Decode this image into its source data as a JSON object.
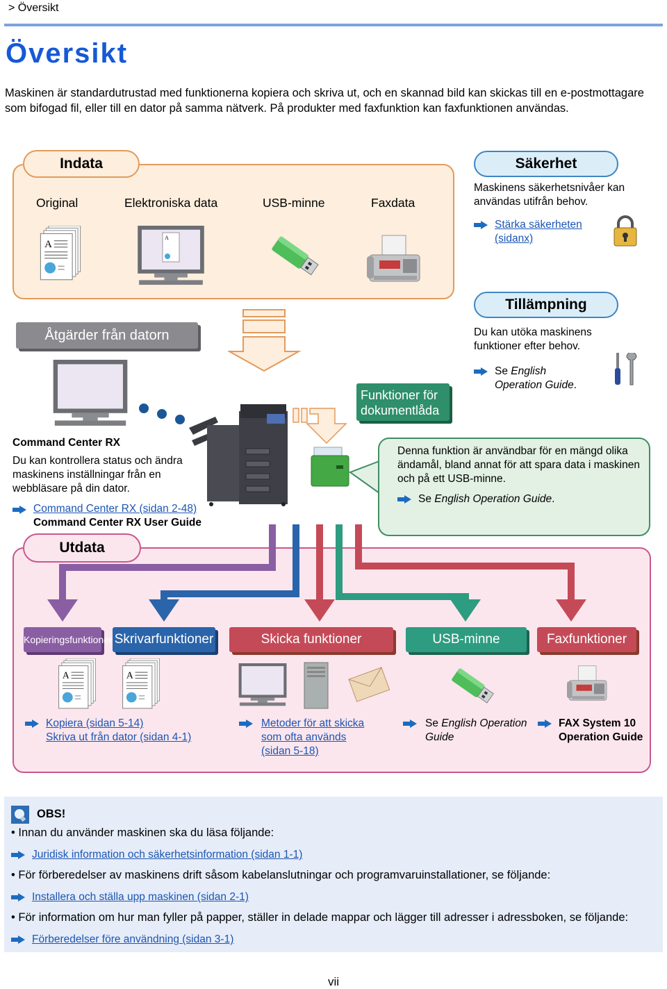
{
  "breadcrumb": "> Översikt",
  "page_title": "Översikt",
  "intro": "Maskinen är standardutrustad med funktionerna kopiera och skriva ut, och en skannad bild kan skickas till en e-postmottagare som bifogad fil, eller till en dator på samma nätverk. På produkter med faxfunktion kan faxfunktionen användas.",
  "indata": {
    "title": "Indata",
    "items": [
      {
        "label": "Original",
        "icon": "document-stack-icon"
      },
      {
        "label": "Elektroniska data",
        "icon": "monitor-icon"
      },
      {
        "label": "USB-minne",
        "icon": "usb-drive-icon"
      },
      {
        "label": "Faxdata",
        "icon": "fax-machine-icon"
      }
    ]
  },
  "security": {
    "title": "Säkerhet",
    "text": "Maskinens säkerhetsnivåer kan användas utifrån behov.",
    "link_line1": "Stärka säkerheten ",
    "link_line2": "(sidanx)",
    "icon": "padlock-icon"
  },
  "application": {
    "title": "Tillämpning",
    "text": "Du kan utöka maskinens funktioner efter behov.",
    "ref_prefix": "Se ",
    "ref_line1_italic": "English",
    "ref_line2_italic": "Operation Guide",
    "ref_suffix": ".",
    "icon": "tools-icon"
  },
  "pc_actions": {
    "label": "Åtgärder från datorn"
  },
  "command_center": {
    "title": "Command Center RX",
    "text": "Du kan kontrollera status och ändra maskinens inställningar från en webbläsare på din dator.",
    "link": "Command Center RX (sidan 2-48)",
    "guide": "Command Center RX User Guide"
  },
  "document_box": {
    "label_line1": "Funktioner för",
    "label_line2": "dokumentlåda",
    "text": "Denna funktion är användbar för en mängd olika ändamål, bland annat för att spara data i maskinen och på ett USB-minne.",
    "ref_prefix": "Se ",
    "ref_italic": "English Operation Guide",
    "ref_suffix": "."
  },
  "utdata": {
    "title": "Utdata",
    "functions": [
      {
        "label": "Kopieringsfunktioner",
        "color": "#8a5ea3"
      },
      {
        "label": "Skrivarfunktioner",
        "color": "#2a64aa"
      },
      {
        "label": "Skicka funktioner",
        "color": "#c54a58"
      },
      {
        "label": "USB-minne",
        "color": "#2e9c80"
      },
      {
        "label": "Faxfunktioner",
        "color": "#c54a58"
      }
    ],
    "links": {
      "copy": "Kopiera (sidan 5-14)",
      "print": "Skriva ut från dator (sidan 4-1)",
      "send_line1": "Metoder för att skicka ",
      "send_line2": "som ofta används ",
      "send_line3": "(sidan 5-18)",
      "usb_prefix": "Se ",
      "usb_italic_line1": "English Operation",
      "usb_italic_line2": "Guide",
      "fax_line1": "FAX System 10",
      "fax_line2": "Operation Guide"
    }
  },
  "obs": {
    "title": "OBS!",
    "items": [
      {
        "text": "Innan du använder maskinen ska du läsa följande:",
        "link": "Juridisk information och säkerhetsinformation (sidan 1-1)"
      },
      {
        "text": "För förberedelser av maskinens drift såsom kabelanslutningar och programvaruinstallationer, se följande:",
        "link": "Installera och ställa upp maskinen (sidan 2-1)"
      },
      {
        "text": "För information om hur man fyller på papper, ställer in delade mappar och lägger till adresser i adressboken, se följande:",
        "link": "Förberedelser före användning (sidan 3-1)"
      }
    ]
  },
  "page_number": "vii",
  "colors": {
    "title_blue": "#1559d6",
    "link_blue": "#1b56b3",
    "indata_orange": "#e39a5a",
    "utdata_pink": "#c9578d",
    "green": "#2e8f6a"
  }
}
